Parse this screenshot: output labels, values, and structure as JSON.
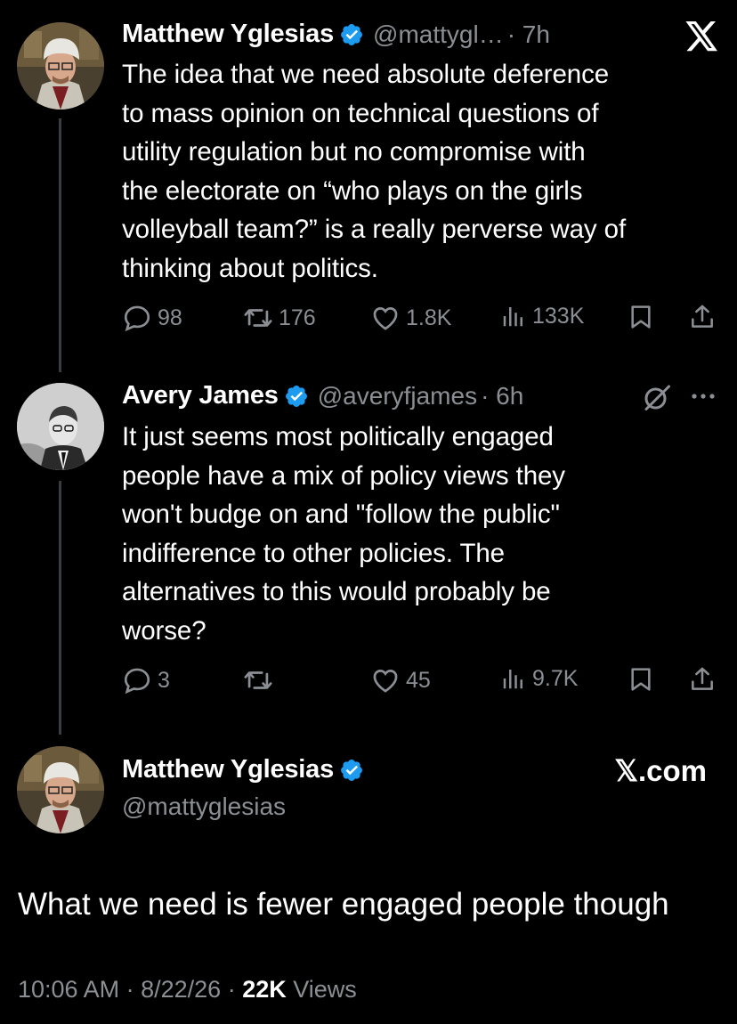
{
  "tweet1": {
    "name": "Matthew Yglesias",
    "handle": "@mattygl…",
    "time": "· 7h",
    "text": "The idea that we need absolute deference\nto mass opinion on technical questions of\nutility regulation but no compromise with\nthe electorate on “who plays on the girls\nvolleyball team?” is a really perverse way of\nthinking about politics.",
    "replies": "98",
    "reposts": "176",
    "likes": "1.8K",
    "views": "133K"
  },
  "tweet2": {
    "name": "Avery James",
    "handle": "@averyfjames",
    "time": "· 6h",
    "text": "It just seems most politically engaged\npeople have a mix of policy views they\nwon't budge on and \"follow the public\"\nindifference to other policies. The\nalternatives to this would probably be\nworse?",
    "replies": "3",
    "reposts": "",
    "likes": "45",
    "views": "9.7K"
  },
  "main_tweet": {
    "name": "Matthew Yglesias",
    "handle": "@mattyglesias",
    "source": "𝕏.com",
    "text": "What we need is fewer engaged people though",
    "time": "10:06 AM",
    "date": "8/22/26",
    "views_count": "22K",
    "views_label": "Views"
  },
  "icons": {
    "x_logo": "x-logo-icon",
    "verified": "verified-badge-icon",
    "reply": "reply-icon",
    "repost": "repost-icon",
    "like": "heart-icon",
    "views": "views-chart-icon",
    "bookmark": "bookmark-icon",
    "share": "share-icon",
    "grok": "grok-icon",
    "more": "more-icon"
  },
  "colors": {
    "background": "#000000",
    "text": "#ffffff",
    "muted": "#8b8f94",
    "verified": "#1d9bf0",
    "thread_line": "#3a3d40"
  }
}
